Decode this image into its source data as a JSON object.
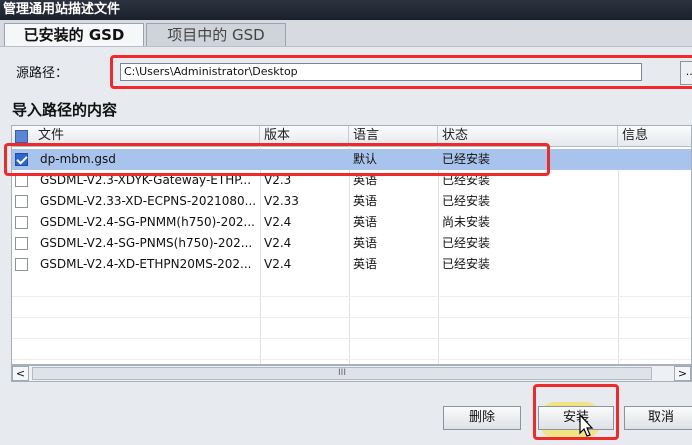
{
  "window": {
    "title": "管理通用站描述文件"
  },
  "tabs": [
    {
      "label": "已安装的 GSD",
      "active": true
    },
    {
      "label": "项目中的 GSD",
      "active": false
    }
  ],
  "source": {
    "label": "源路径：",
    "value": "C:\\Users\\Administrator\\Desktop",
    "browse_label": "..."
  },
  "content": {
    "title": "导入路径的内容",
    "columns": [
      "文件",
      "版本",
      "语言",
      "状态",
      "信息"
    ],
    "rows": [
      {
        "file": "dp-mbm.gsd",
        "version": "",
        "language": "默认",
        "status": "已经安装",
        "checked": true,
        "selected": true
      },
      {
        "file": "GSDML-V2.3-XDYK-Gateway-ETHP...",
        "version": "V2.3",
        "language": "英语",
        "status": "已经安装",
        "checked": false,
        "selected": false
      },
      {
        "file": "GSDML-V2.33-XD-ECPNS-2021080...",
        "version": "V2.33",
        "language": "英语",
        "status": "已经安装",
        "checked": false,
        "selected": false
      },
      {
        "file": "GSDML-V2.4-SG-PNMM(h750)-202...",
        "version": "V2.4",
        "language": "英语",
        "status": "尚未安装",
        "checked": false,
        "selected": false
      },
      {
        "file": "GSDML-V2.4-SG-PNMS(h750)-202...",
        "version": "V2.4",
        "language": "英语",
        "status": "已经安装",
        "checked": false,
        "selected": false
      },
      {
        "file": "GSDML-V2.4-XD-ETHPN20MS-202...",
        "version": "V2.4",
        "language": "英语",
        "status": "已经安装",
        "checked": false,
        "selected": false
      }
    ]
  },
  "scrollbar": {
    "left": "<",
    "right": ">",
    "thumb": "III"
  },
  "buttons": {
    "delete": "删除",
    "install": "安装",
    "cancel": "取消"
  },
  "colors": {
    "annotation": "#ee2a2a",
    "selection": "#a9c4ec",
    "highlight": "#f6e04a"
  }
}
